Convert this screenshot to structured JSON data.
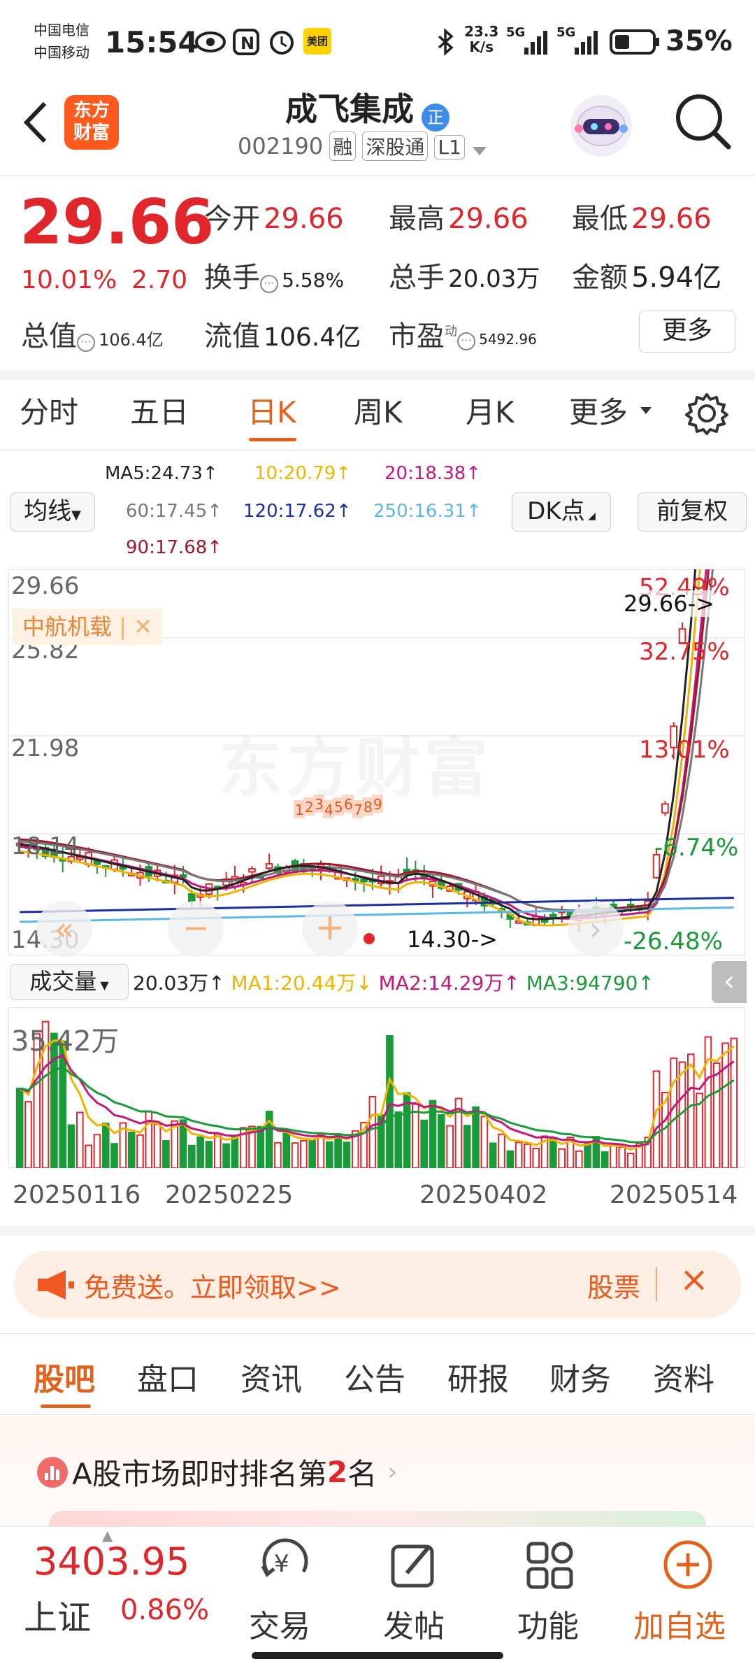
{
  "status": {
    "carrier1": "中国电信",
    "carrier2": "中国移动",
    "time": "15:54",
    "speed_num": "23.3",
    "speed_unit": "K/s",
    "net1": "5G",
    "net2": "5G",
    "battery": "35%",
    "meituan": "美团"
  },
  "header": {
    "back_icon": "chevron-left-icon",
    "logo_line1": "东方",
    "logo_line2": "财富",
    "title": "成飞集成",
    "badge": "正",
    "code": "002190",
    "tags": [
      "融",
      "深股通",
      "L1"
    ]
  },
  "quote": {
    "price": "29.66",
    "change_pct": "10.01%",
    "change_amt": "2.70",
    "fields": {
      "open_label": "今开",
      "open": "29.66",
      "high_label": "最高",
      "high": "29.66",
      "low_label": "最低",
      "low": "29.66",
      "turnover_label": "换手",
      "turnover": "5.58%",
      "volume_label": "总手",
      "volume": "20.03万",
      "amount_label": "金额",
      "amount": "5.94亿",
      "mcap_label": "总值",
      "mcap": "106.4亿",
      "float_label": "流值",
      "float": "106.4亿",
      "pe_label": "市盈",
      "pe_sup": "动",
      "pe": "5492.96"
    },
    "more_button": "更多"
  },
  "chart_tabs": {
    "items": [
      "分时",
      "五日",
      "日K",
      "周K",
      "月K",
      "更多"
    ],
    "active": "日K"
  },
  "ma_legend": {
    "selector": "均线",
    "ma5": "MA5:24.73↑",
    "ma10": "10:20.79↑",
    "ma20": "20:18.38↑",
    "ma60": "60:17.45↑",
    "ma120": "120:17.62↑",
    "ma250": "250:16.31↑",
    "ma90": "90:17.68↑",
    "dk_button": "DK点",
    "fq_button": "前复权",
    "colors": {
      "ma5": "#222222",
      "ma10": "#f0b400",
      "ma20": "#c2187e",
      "ma60": "#777777",
      "ma120": "#1b2fa0",
      "ma250": "#5bb8e6",
      "ma90": "#a0162b"
    }
  },
  "kline": {
    "y_labels": [
      "29.66",
      "25.82",
      "21.98",
      "18.14",
      "14.30"
    ],
    "pct_labels_up": [
      "52.49%",
      "32.75%",
      "13.01%"
    ],
    "pct_labels_down": [
      "-6.74%",
      "-26.48%"
    ],
    "high_marker": "29.66->",
    "low_marker": "14.30->",
    "concept_tag": "中航机载",
    "watermark": "东方财富",
    "sequence_marks": [
      "1",
      "2",
      "3",
      "4",
      "5",
      "6",
      "7",
      "8",
      "9"
    ]
  },
  "volume": {
    "selector": "成交量",
    "current": "20.03万↑",
    "ma1": "MA1:20.44万↓",
    "ma2": "MA2:14.29万↑",
    "ma3": "MA3:94790↑",
    "max_label": "35.42万",
    "dates": [
      "20250116",
      "20250225",
      "20250402",
      "20250514"
    ]
  },
  "ad_banner": {
    "text": "免费送。立即领取>>",
    "right_text": "股票",
    "close": "×"
  },
  "sub_tabs": {
    "items": [
      "股吧",
      "盘口",
      "资讯",
      "公告",
      "研报",
      "财务",
      "资料"
    ],
    "active": "股吧"
  },
  "ranking": {
    "prefix": "A股市场即时排名第",
    "rank": "2",
    "suffix": "名"
  },
  "bottom_bar": {
    "index_value": "3403.95",
    "index_name": "上证",
    "index_change": "0.86%",
    "trade": "交易",
    "post": "发帖",
    "function": "功能",
    "add_watch": "加自选"
  }
}
